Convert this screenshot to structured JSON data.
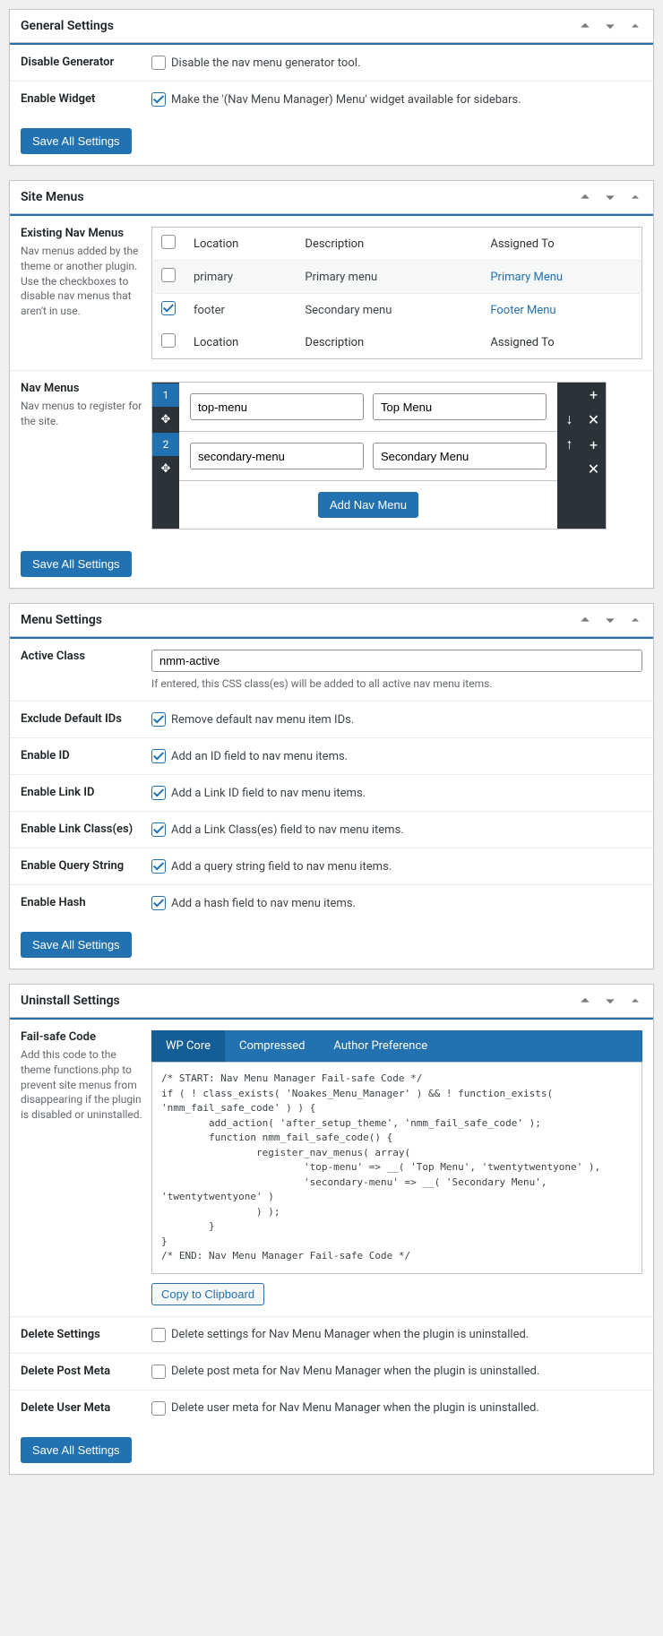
{
  "panels": {
    "general": {
      "title": "General Settings",
      "rows": {
        "disable_gen": {
          "label": "Disable Generator",
          "desc": "Disable the nav menu generator tool.",
          "checked": false
        },
        "enable_widget": {
          "label": "Enable Widget",
          "desc": "Make the '(Nav Menu Manager) Menu' widget available for sidebars.",
          "checked": true
        }
      },
      "save": "Save All Settings"
    },
    "site_menus": {
      "title": "Site Menus",
      "existing": {
        "label": "Existing Nav Menus",
        "hint": "Nav menus added by the theme or another plugin. Use the checkboxes to disable nav menus that aren't in use.",
        "cols": {
          "loc": "Location",
          "desc": "Description",
          "assigned": "Assigned To"
        },
        "rows": [
          {
            "checked": false,
            "loc": "primary",
            "desc": "Primary menu",
            "assigned": "Primary Menu"
          },
          {
            "checked": true,
            "loc": "footer",
            "desc": "Secondary menu",
            "assigned": "Footer Menu"
          }
        ]
      },
      "nav_menus": {
        "label": "Nav Menus",
        "hint": "Nav menus to register for the site.",
        "items": [
          {
            "num": "1",
            "slug": "top-menu",
            "name": "Top Menu"
          },
          {
            "num": "2",
            "slug": "secondary-menu",
            "name": "Secondary Menu"
          }
        ],
        "add": "Add Nav Menu"
      },
      "save": "Save All Settings"
    },
    "menu_settings": {
      "title": "Menu Settings",
      "active_class": {
        "label": "Active Class",
        "value": "nmm-active",
        "hint": "If entered, this CSS class(es) will be added to all active nav menu items."
      },
      "rows": {
        "exclude_ids": {
          "label": "Exclude Default IDs",
          "desc": "Remove default nav menu item IDs.",
          "checked": true
        },
        "enable_id": {
          "label": "Enable ID",
          "desc": "Add an ID field to nav menu items.",
          "checked": true
        },
        "enable_link_id": {
          "label": "Enable Link ID",
          "desc": "Add a Link ID field to nav menu items.",
          "checked": true
        },
        "enable_link_class": {
          "label": "Enable Link Class(es)",
          "desc": "Add a Link Class(es) field to nav menu items.",
          "checked": true
        },
        "enable_query": {
          "label": "Enable Query String",
          "desc": "Add a query string field to nav menu items.",
          "checked": true
        },
        "enable_hash": {
          "label": "Enable Hash",
          "desc": "Add a hash field to nav menu items.",
          "checked": true
        }
      },
      "save": "Save All Settings"
    },
    "uninstall": {
      "title": "Uninstall Settings",
      "failsafe": {
        "label": "Fail-safe Code",
        "hint": "Add this code to the theme functions.php to prevent site menus from disappearing if the plugin is disabled or uninstalled.",
        "tabs": {
          "wp": "WP Core",
          "comp": "Compressed",
          "auth": "Author Preference"
        },
        "code": "/* START: Nav Menu Manager Fail-safe Code */\nif ( ! class_exists( 'Noakes_Menu_Manager' ) && ! function_exists( 'nmm_fail_safe_code' ) ) {\n        add_action( 'after_setup_theme', 'nmm_fail_safe_code' );\n        function nmm_fail_safe_code() {\n                register_nav_menus( array(\n                        'top-menu' => __( 'Top Menu', 'twentytwentyone' ),\n                        'secondary-menu' => __( 'Secondary Menu', 'twentytwentyone' )\n                ) );\n        }\n}\n/* END: Nav Menu Manager Fail-safe Code */",
        "copy": "Copy to Clipboard"
      },
      "rows": {
        "del_settings": {
          "label": "Delete Settings",
          "desc": "Delete settings for Nav Menu Manager when the plugin is uninstalled.",
          "checked": false
        },
        "del_post": {
          "label": "Delete Post Meta",
          "desc": "Delete post meta for Nav Menu Manager when the plugin is uninstalled.",
          "checked": false
        },
        "del_user": {
          "label": "Delete User Meta",
          "desc": "Delete user meta for Nav Menu Manager when the plugin is uninstalled.",
          "checked": false
        }
      },
      "save": "Save All Settings"
    }
  }
}
